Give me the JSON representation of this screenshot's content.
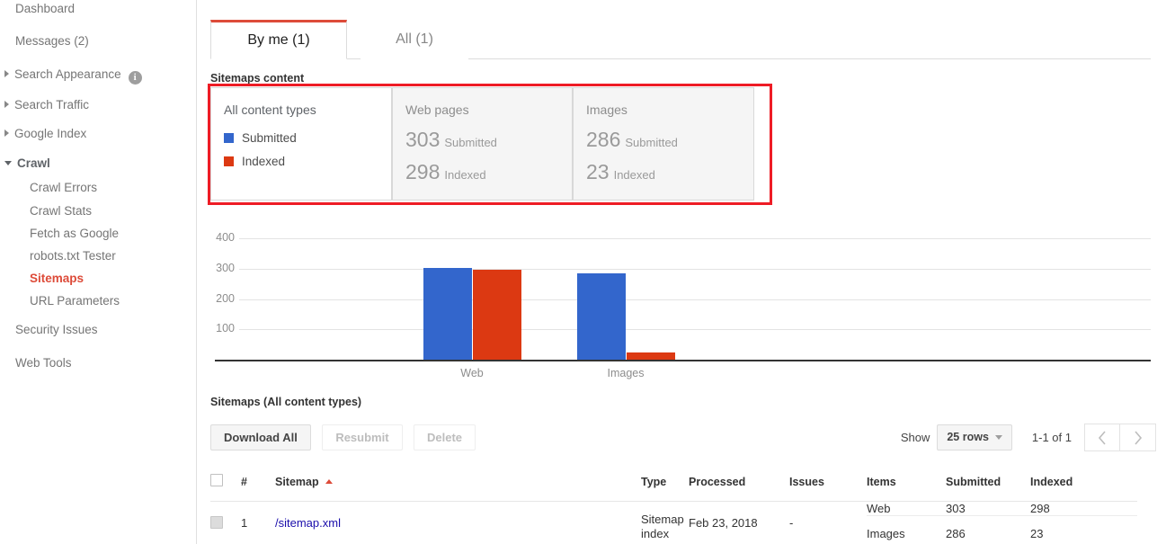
{
  "sidebar": {
    "items": [
      {
        "label": "Dashboard",
        "type": "top",
        "state": "normal"
      },
      {
        "label": "Messages (2)",
        "type": "top",
        "state": "normal"
      },
      {
        "label": "Search Appearance",
        "type": "group",
        "state": "collapsed",
        "badge": "i"
      },
      {
        "label": "Search Traffic",
        "type": "group",
        "state": "collapsed"
      },
      {
        "label": "Google Index",
        "type": "group",
        "state": "collapsed"
      },
      {
        "label": "Crawl",
        "type": "group",
        "state": "expanded"
      },
      {
        "label": "Crawl Errors",
        "type": "sub",
        "state": "normal"
      },
      {
        "label": "Crawl Stats",
        "type": "sub",
        "state": "normal"
      },
      {
        "label": "Fetch as Google",
        "type": "sub",
        "state": "normal"
      },
      {
        "label": "robots.txt Tester",
        "type": "sub",
        "state": "normal"
      },
      {
        "label": "Sitemaps",
        "type": "sub",
        "state": "active"
      },
      {
        "label": "URL Parameters",
        "type": "sub",
        "state": "normal"
      },
      {
        "label": "Security Issues",
        "type": "top",
        "state": "normal"
      },
      {
        "label": "Web Tools",
        "type": "top",
        "state": "normal"
      }
    ]
  },
  "tabs": [
    {
      "label": "By me (1)",
      "active": true
    },
    {
      "label": "All (1)",
      "active": false
    }
  ],
  "sitemaps_content": {
    "heading": "Sitemaps content",
    "cards": [
      {
        "title": "All content types",
        "legend": [
          {
            "label": "Submitted",
            "color": "#3366cc"
          },
          {
            "label": "Indexed",
            "color": "#dc3912"
          }
        ]
      },
      {
        "title": "Web pages",
        "stats": [
          {
            "value": "303",
            "label": "Submitted"
          },
          {
            "value": "298",
            "label": "Indexed"
          }
        ]
      },
      {
        "title": "Images",
        "stats": [
          {
            "value": "286",
            "label": "Submitted"
          },
          {
            "value": "23",
            "label": "Indexed"
          }
        ]
      }
    ]
  },
  "chart_data": {
    "type": "bar",
    "title": "",
    "xlabel": "",
    "ylabel": "",
    "categories": [
      "Web",
      "Images"
    ],
    "series": [
      {
        "name": "Submitted",
        "color": "#3366cc",
        "values": [
          303,
          286
        ]
      },
      {
        "name": "Indexed",
        "color": "#dc3912",
        "values": [
          298,
          23
        ]
      }
    ],
    "ylim": [
      0,
      440
    ],
    "yticks": [
      "400",
      "300",
      "200",
      "100"
    ],
    "ytick_values": [
      400,
      300,
      200,
      100
    ],
    "grid": true,
    "legend_position": "none"
  },
  "table_section": {
    "heading": "Sitemaps (All content types)",
    "buttons": [
      {
        "label": "Download All",
        "disabled": false
      },
      {
        "label": "Resubmit",
        "disabled": true
      },
      {
        "label": "Delete",
        "disabled": true
      }
    ],
    "pagination": {
      "show_label": "Show",
      "rows_value": "25 rows",
      "range": "1-1 of 1",
      "prev_icon": "chevron-left-icon",
      "next_icon": "chevron-right-icon"
    },
    "columns": [
      {
        "label": "#",
        "muted": true,
        "sorted": false
      },
      {
        "label": "Sitemap",
        "muted": false,
        "sorted": true
      },
      {
        "label": "Type",
        "muted": false,
        "sorted": false
      },
      {
        "label": "Processed",
        "muted": false,
        "sorted": false
      },
      {
        "label": "Issues",
        "muted": false,
        "sorted": false
      },
      {
        "label": "Items",
        "muted": true,
        "sorted": false
      },
      {
        "label": "Submitted",
        "muted": true,
        "sorted": false
      },
      {
        "label": "Indexed",
        "muted": true,
        "sorted": false
      }
    ],
    "rows": [
      {
        "num": "1",
        "sitemap": "/sitemap.xml",
        "type": "Sitemap index",
        "processed": "Feb 23, 2018",
        "issues": "-",
        "items": [
          {
            "kind": "Web",
            "submitted": "303",
            "indexed": "298"
          },
          {
            "kind": "Images",
            "submitted": "286",
            "indexed": "23"
          }
        ]
      }
    ]
  },
  "annotation": {
    "color": "#ee1c25"
  }
}
